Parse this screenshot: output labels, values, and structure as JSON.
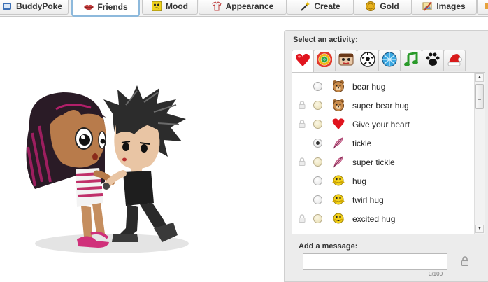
{
  "tabs": [
    {
      "label": "BuddyPoke",
      "icon": "buddypoke-icon"
    },
    {
      "label": "Friends",
      "icon": "lips-icon"
    },
    {
      "label": "Mood",
      "icon": "mood-face-icon"
    },
    {
      "label": "Appearance",
      "icon": "shirt-icon"
    },
    {
      "label": "Create",
      "icon": "magic-wand-icon"
    },
    {
      "label": "Gold",
      "icon": "gold-coin-icon"
    },
    {
      "label": "Images",
      "icon": "images-icon"
    }
  ],
  "active_tab": "Friends",
  "panel": {
    "title": "Select an activity:",
    "categories": [
      "heart-icon",
      "swirl-icon",
      "face-icon",
      "soccer-ball-icon",
      "disco-ball-icon",
      "music-note-icon",
      "paw-print-icon",
      "santa-hat-icon"
    ],
    "activities": [
      {
        "label": "bear hug",
        "icon": "bear-icon",
        "locked": false,
        "selected": false
      },
      {
        "label": "super bear hug",
        "icon": "bear-icon",
        "locked": true,
        "selected": false
      },
      {
        "label": "Give your heart",
        "icon": "heart-icon",
        "locked": true,
        "selected": false
      },
      {
        "label": "tickle",
        "icon": "feather-icon",
        "locked": false,
        "selected": true
      },
      {
        "label": "super tickle",
        "icon": "feather-icon",
        "locked": true,
        "selected": false
      },
      {
        "label": "hug",
        "icon": "hug-smiley-icon",
        "locked": false,
        "selected": false
      },
      {
        "label": "twirl hug",
        "icon": "hug-smiley-icon",
        "locked": false,
        "selected": false
      },
      {
        "label": "excited hug",
        "icon": "hug-smiley-icon",
        "locked": true,
        "selected": false
      }
    ],
    "message": {
      "title": "Add a message:",
      "value": "",
      "placeholder": "",
      "counter": "0/100"
    }
  },
  "colors": {
    "active_tab_border": "#8db9dc",
    "panel_bg": "#ececec",
    "heart": "#e0141e"
  }
}
